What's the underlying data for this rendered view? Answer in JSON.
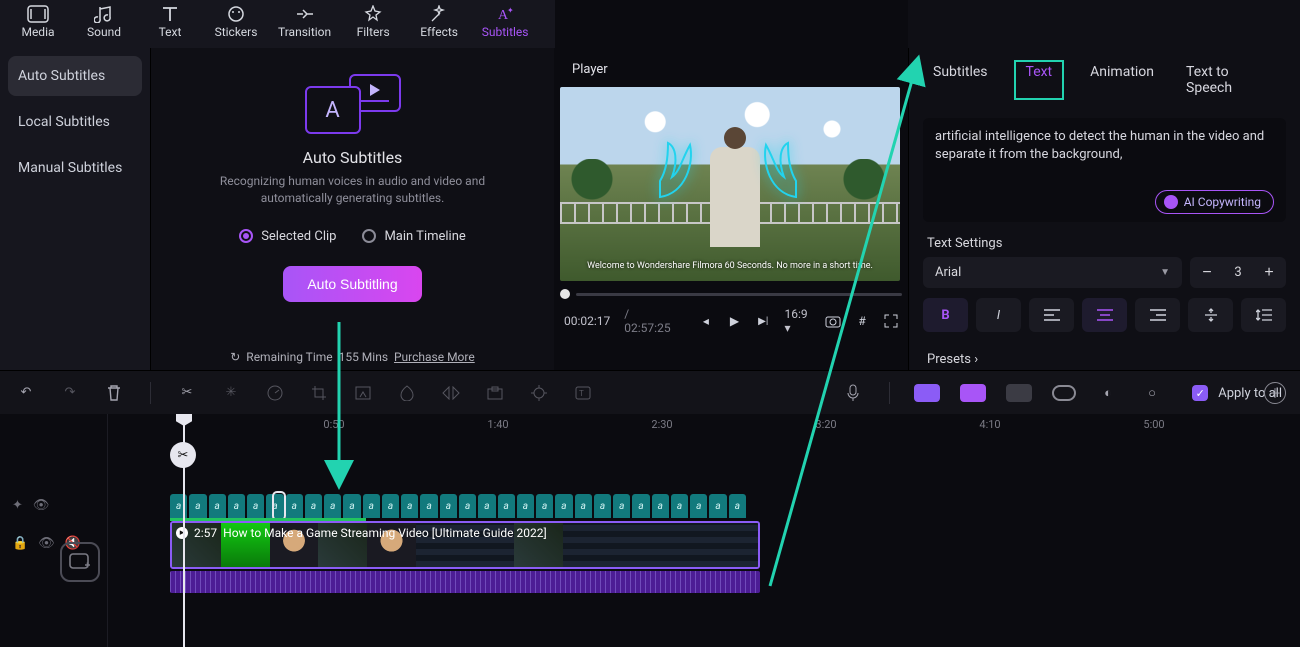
{
  "main_tabs": {
    "media": "Media",
    "sound": "Sound",
    "text": "Text",
    "stickers": "Stickers",
    "transition": "Transition",
    "filters": "Filters",
    "effects": "Effects",
    "subtitles": "Subtitles"
  },
  "side": {
    "auto": "Auto Subtitles",
    "local": "Local Subtitles",
    "manual": "Manual Subtitles"
  },
  "center": {
    "title": "Auto Subtitles",
    "desc": "Recognizing human voices in audio and video and automatically generating subtitles.",
    "radio_selected": "Selected Clip",
    "radio_main": "Main Timeline",
    "button": "Auto Subtitling",
    "refresh_icon": "↻",
    "remaining_label": "Remaining Time",
    "remaining_value": "155 Mins",
    "purchase": "Purchase More"
  },
  "player": {
    "title": "Player",
    "caption": "Welcome to Wondershare Filmora 60 Seconds. No more in a short time.",
    "time_current": "00:02:17",
    "time_total": "02:57:25",
    "aspect": "16:9"
  },
  "inspector": {
    "tabs": {
      "subtitles": "Subtitles",
      "text": "Text",
      "animation": "Animation",
      "tts": "Text to Speech"
    },
    "subtitle_text": "artificial intelligence to detect the human in the video and separate it from the background,",
    "ai_btn": "AI Copywriting",
    "text_settings_label": "Text Settings",
    "font": "Arial",
    "size": "3",
    "presets_label": "Presets",
    "presets_caret": "›",
    "apply_all": "Apply to all"
  },
  "ruler": {
    "t1": "0:50",
    "t2": "1:40",
    "t3": "2:30",
    "t4": "3:20",
    "t5": "4:10",
    "t6": "5:00"
  },
  "clip": {
    "time": "2:57",
    "title": "How to Make a Game Streaming Video [Ultimate Guide 2022]"
  },
  "glyphs": {
    "A": "A",
    "italic_a": "a"
  },
  "colors": {
    "accent": "#a855f7",
    "teal": "#22d3b0",
    "subtitle_track": "#127a7d"
  }
}
